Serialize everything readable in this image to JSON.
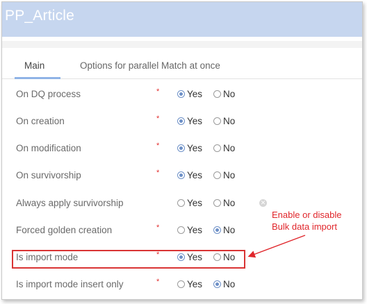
{
  "window": {
    "title": "PP_Article"
  },
  "tabs": [
    {
      "label": "Main",
      "active": true
    },
    {
      "label": "Options for parallel Match at once",
      "active": false
    }
  ],
  "radio_labels": {
    "yes": "Yes",
    "no": "No"
  },
  "required_mark": "*",
  "fields": [
    {
      "label": "On DQ process",
      "required": true,
      "value": "Yes"
    },
    {
      "label": "On creation",
      "required": true,
      "value": "Yes"
    },
    {
      "label": "On modification",
      "required": true,
      "value": "Yes"
    },
    {
      "label": "On survivorship",
      "required": true,
      "value": "Yes"
    },
    {
      "label": "Always apply survivorship",
      "required": false,
      "value": "",
      "clearable": true
    },
    {
      "label": "Forced golden creation",
      "required": true,
      "value": "No"
    },
    {
      "label": "Is import mode",
      "required": true,
      "value": "Yes",
      "highlighted": true
    },
    {
      "label": "Is import mode insert only",
      "required": true,
      "value": "No"
    }
  ],
  "annotation": {
    "line1": "Enable or disable",
    "line2": "Bulk data import",
    "color": "#e0262b"
  },
  "colors": {
    "titlebar": "#c6d6ef",
    "tab_underline": "#8fb3e6",
    "radio_checked": "#6d90c7",
    "required": "#e23030"
  }
}
